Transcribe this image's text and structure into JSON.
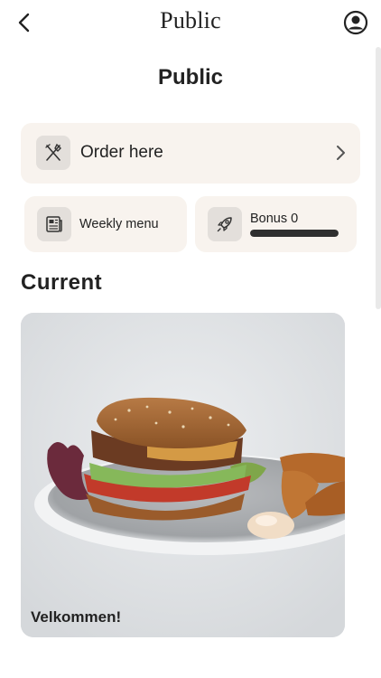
{
  "header": {
    "brand": "Public",
    "back_icon": "chevron-left-icon",
    "profile_icon": "user-circle-icon"
  },
  "page": {
    "title": "Public"
  },
  "order": {
    "label": "Order here",
    "icon": "fork-knife-icon",
    "chevron": "chevron-right-icon"
  },
  "weekly_menu": {
    "label": "Weekly menu",
    "icon": "newspaper-icon"
  },
  "bonus": {
    "label": "Bonus 0",
    "icon": "rocket-icon",
    "progress": 1.0
  },
  "current": {
    "title": "Current",
    "feature_caption": "Velkommen!",
    "image": "burger-with-potato-wedges"
  },
  "colors": {
    "card_background": "#f8f3ee",
    "icon_tile": "#e3dfdb",
    "text": "#222222",
    "progress_fill": "#2f2f2f"
  }
}
